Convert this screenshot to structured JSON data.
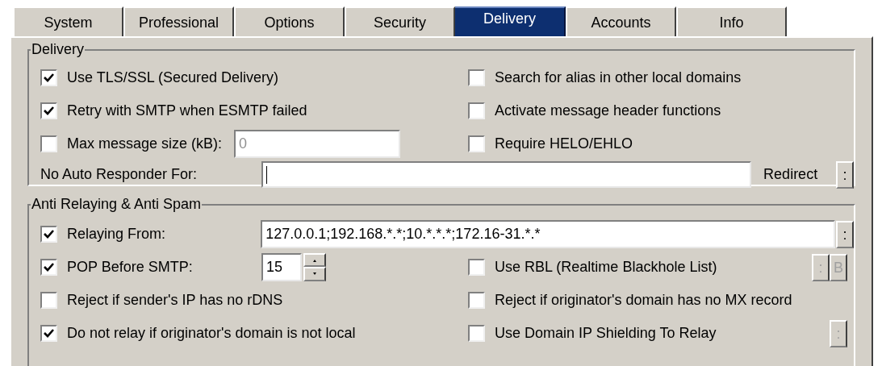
{
  "tabs": [
    {
      "label": "System",
      "selected": false
    },
    {
      "label": "Professional",
      "selected": false
    },
    {
      "label": "Options",
      "selected": false
    },
    {
      "label": "Security",
      "selected": false
    },
    {
      "label": "Delivery",
      "selected": true
    },
    {
      "label": "Accounts",
      "selected": false
    },
    {
      "label": "Info",
      "selected": false
    }
  ],
  "delivery": {
    "title": "Delivery",
    "left": [
      {
        "kind": "check",
        "label": "Use TLS/SSL (Secured Delivery)",
        "checked": true
      },
      {
        "kind": "check",
        "label": "Retry with SMTP when ESMTP failed",
        "checked": true
      },
      {
        "kind": "check_field",
        "label": "Max message size (kB):",
        "checked": false,
        "value": "0",
        "disabled": true
      }
    ],
    "right": [
      {
        "label": "Search for alias in other local domains",
        "checked": false
      },
      {
        "label": "Activate message header functions",
        "checked": false
      },
      {
        "label": "Require HELO/EHLO",
        "checked": false
      }
    ],
    "auto_responder": {
      "label": "No Auto Responder For:",
      "redirect": "Redirect",
      "button": {
        "label": ":",
        "disabled": false
      }
    }
  },
  "anti_spam": {
    "title": "Anti Relaying & Anti Spam",
    "relaying": {
      "label": "Relaying From:",
      "checked": true,
      "value": "127.0.0.1;192.168.*.*;10.*.*.*;172.16-31.*.*",
      "button": {
        "label": ":",
        "disabled": false
      }
    },
    "left": [
      {
        "kind": "spinner",
        "label": "POP Before SMTP:",
        "checked": true,
        "value": "15"
      },
      {
        "kind": "check",
        "label": "Reject if sender's IP has no rDNS",
        "checked": false
      },
      {
        "kind": "check",
        "label": "Do not relay if originator's domain is not local",
        "checked": true
      }
    ],
    "right": [
      {
        "label": "Use RBL (Realtime Blackhole List)",
        "checked": false,
        "buttons": [
          {
            "label": ":",
            "disabled": true
          },
          {
            "label": "B",
            "disabled": true
          }
        ]
      },
      {
        "label": "Reject if originator's domain has no MX record",
        "checked": false
      },
      {
        "label": "Use Domain IP Shielding To Relay",
        "checked": false,
        "buttons": [
          {
            "label": ":",
            "disabled": true
          }
        ]
      }
    ]
  }
}
